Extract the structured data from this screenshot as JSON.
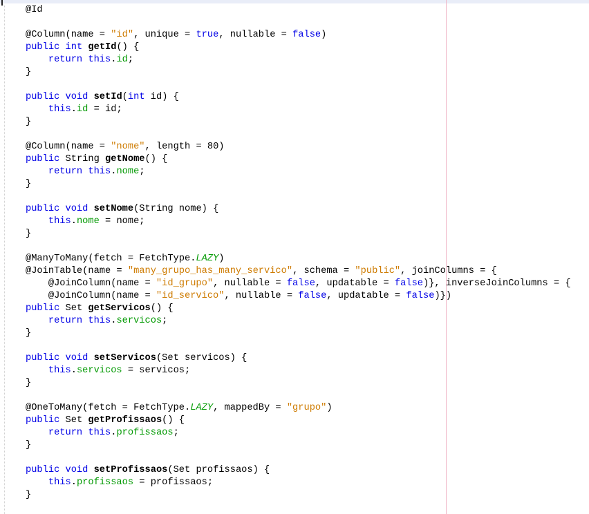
{
  "editor": {
    "lines": [
      [
        {
          "t": "@Id"
        }
      ],
      [],
      [
        {
          "t": "@Column(name = "
        },
        {
          "t": "\"id\"",
          "c": "str"
        },
        {
          "t": ", unique = "
        },
        {
          "t": "true",
          "c": "kw"
        },
        {
          "t": ", nullable = "
        },
        {
          "t": "false",
          "c": "kw"
        },
        {
          "t": ")"
        }
      ],
      [
        {
          "t": "public",
          "c": "kw"
        },
        {
          "t": " "
        },
        {
          "t": "int",
          "c": "kw"
        },
        {
          "t": " "
        },
        {
          "t": "getId",
          "c": "mth"
        },
        {
          "t": "() {"
        }
      ],
      [
        {
          "t": "    "
        },
        {
          "t": "return",
          "c": "kw"
        },
        {
          "t": " "
        },
        {
          "t": "this",
          "c": "kw"
        },
        {
          "t": "."
        },
        {
          "t": "id",
          "c": "fld"
        },
        {
          "t": ";"
        }
      ],
      [
        {
          "t": "}"
        }
      ],
      [],
      [
        {
          "t": "public",
          "c": "kw"
        },
        {
          "t": " "
        },
        {
          "t": "void",
          "c": "kw"
        },
        {
          "t": " "
        },
        {
          "t": "setId",
          "c": "mth"
        },
        {
          "t": "("
        },
        {
          "t": "int",
          "c": "kw"
        },
        {
          "t": " id) {"
        }
      ],
      [
        {
          "t": "    "
        },
        {
          "t": "this",
          "c": "kw"
        },
        {
          "t": "."
        },
        {
          "t": "id",
          "c": "fld"
        },
        {
          "t": " = id;"
        }
      ],
      [
        {
          "t": "}"
        }
      ],
      [],
      [
        {
          "t": "@Column(name = "
        },
        {
          "t": "\"nome\"",
          "c": "str"
        },
        {
          "t": ", length = 80)"
        }
      ],
      [
        {
          "t": "public",
          "c": "kw"
        },
        {
          "t": " String "
        },
        {
          "t": "getNome",
          "c": "mth"
        },
        {
          "t": "() {"
        }
      ],
      [
        {
          "t": "    "
        },
        {
          "t": "return",
          "c": "kw"
        },
        {
          "t": " "
        },
        {
          "t": "this",
          "c": "kw"
        },
        {
          "t": "."
        },
        {
          "t": "nome",
          "c": "fld"
        },
        {
          "t": ";"
        }
      ],
      [
        {
          "t": "}"
        }
      ],
      [],
      [
        {
          "t": "public",
          "c": "kw"
        },
        {
          "t": " "
        },
        {
          "t": "void",
          "c": "kw"
        },
        {
          "t": " "
        },
        {
          "t": "setNome",
          "c": "mth"
        },
        {
          "t": "(String nome) {"
        }
      ],
      [
        {
          "t": "    "
        },
        {
          "t": "this",
          "c": "kw"
        },
        {
          "t": "."
        },
        {
          "t": "nome",
          "c": "fld"
        },
        {
          "t": " = nome;"
        }
      ],
      [
        {
          "t": "}"
        }
      ],
      [],
      [
        {
          "t": "@ManyToMany(fetch = FetchType."
        },
        {
          "t": "LAZY",
          "c": "cst"
        },
        {
          "t": ")"
        }
      ],
      [
        {
          "t": "@JoinTable(name = "
        },
        {
          "t": "\"many_grupo_has_many_servico\"",
          "c": "str"
        },
        {
          "t": ", schema = "
        },
        {
          "t": "\"public\"",
          "c": "str"
        },
        {
          "t": ", joinColumns = {"
        }
      ],
      [
        {
          "t": "    @JoinColumn(name = "
        },
        {
          "t": "\"id_grupo\"",
          "c": "str"
        },
        {
          "t": ", nullable = "
        },
        {
          "t": "false",
          "c": "kw"
        },
        {
          "t": ", updatable = "
        },
        {
          "t": "false",
          "c": "kw"
        },
        {
          "t": ")}, inverseJoinColumns = {"
        }
      ],
      [
        {
          "t": "    @JoinColumn(name = "
        },
        {
          "t": "\"id_servico\"",
          "c": "str"
        },
        {
          "t": ", nullable = "
        },
        {
          "t": "false",
          "c": "kw"
        },
        {
          "t": ", updatable = "
        },
        {
          "t": "false",
          "c": "kw"
        },
        {
          "t": ")})"
        }
      ],
      [
        {
          "t": "public",
          "c": "kw"
        },
        {
          "t": " Set "
        },
        {
          "t": "getServicos",
          "c": "mth"
        },
        {
          "t": "() {"
        }
      ],
      [
        {
          "t": "    "
        },
        {
          "t": "return",
          "c": "kw"
        },
        {
          "t": " "
        },
        {
          "t": "this",
          "c": "kw"
        },
        {
          "t": "."
        },
        {
          "t": "servicos",
          "c": "fld"
        },
        {
          "t": ";"
        }
      ],
      [
        {
          "t": "}"
        }
      ],
      [],
      [
        {
          "t": "public",
          "c": "kw"
        },
        {
          "t": " "
        },
        {
          "t": "void",
          "c": "kw"
        },
        {
          "t": " "
        },
        {
          "t": "setServicos",
          "c": "mth"
        },
        {
          "t": "(Set servicos) {"
        }
      ],
      [
        {
          "t": "    "
        },
        {
          "t": "this",
          "c": "kw"
        },
        {
          "t": "."
        },
        {
          "t": "servicos",
          "c": "fld"
        },
        {
          "t": " = servicos;"
        }
      ],
      [
        {
          "t": "}"
        }
      ],
      [],
      [
        {
          "t": "@OneToMany(fetch = FetchType."
        },
        {
          "t": "LAZY",
          "c": "cst"
        },
        {
          "t": ", mappedBy = "
        },
        {
          "t": "\"grupo\"",
          "c": "str"
        },
        {
          "t": ")"
        }
      ],
      [
        {
          "t": "public",
          "c": "kw"
        },
        {
          "t": " Set "
        },
        {
          "t": "getProfissaos",
          "c": "mth"
        },
        {
          "t": "() {"
        }
      ],
      [
        {
          "t": "    "
        },
        {
          "t": "return",
          "c": "kw"
        },
        {
          "t": " "
        },
        {
          "t": "this",
          "c": "kw"
        },
        {
          "t": "."
        },
        {
          "t": "profissaos",
          "c": "fld"
        },
        {
          "t": ";"
        }
      ],
      [
        {
          "t": "}"
        }
      ],
      [],
      [
        {
          "t": "public",
          "c": "kw"
        },
        {
          "t": " "
        },
        {
          "t": "void",
          "c": "kw"
        },
        {
          "t": " "
        },
        {
          "t": "setProfissaos",
          "c": "mth"
        },
        {
          "t": "(Set profissaos) {"
        }
      ],
      [
        {
          "t": "    "
        },
        {
          "t": "this",
          "c": "kw"
        },
        {
          "t": "."
        },
        {
          "t": "profissaos",
          "c": "fld"
        },
        {
          "t": " = profissaos;"
        }
      ],
      [
        {
          "t": "}"
        }
      ],
      []
    ]
  }
}
